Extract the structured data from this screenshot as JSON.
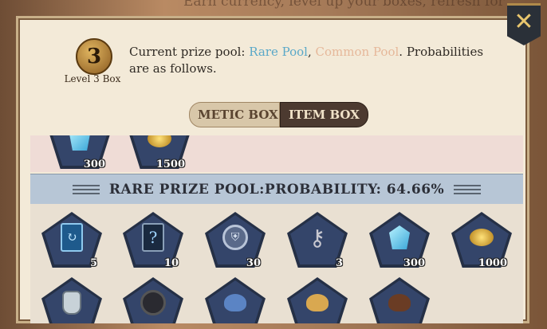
{
  "backdrop_text": "Earn currency, level up your boxes, refresh for",
  "close_icon": "close-x-icon",
  "box": {
    "level_number": "3",
    "level_label": "Level 3 Box"
  },
  "pool_info": {
    "prefix": "Current prize pool: ",
    "rare_label": "Rare Pool",
    "separator": ", ",
    "common_label": "Common Pool",
    "suffix": ". Probabilities are as follows."
  },
  "tabs": [
    {
      "label": "COSMETIC BOX",
      "visible_text": "METIC BOX",
      "active": false
    },
    {
      "label": "ITEM BOX",
      "active": true
    }
  ],
  "colors": {
    "rare": "#5aa8c8",
    "common": "#e6b89a",
    "tab_active": "#4c3a30"
  },
  "top_row_items": [
    {
      "icon": "gem-icon",
      "qty": "300"
    },
    {
      "icon": "coin-icon",
      "qty": "1500"
    }
  ],
  "rare_pool": {
    "title": "RARE PRIZE POOL:PROBABILITY: 64.66%",
    "items": [
      {
        "icon": "blue-card-icon",
        "qty": "5"
      },
      {
        "icon": "mystery-card-icon",
        "qty": "10"
      },
      {
        "icon": "shield-token-icon",
        "qty": "30"
      },
      {
        "icon": "key-icon",
        "qty": "3"
      },
      {
        "icon": "gem-icon",
        "qty": "300"
      },
      {
        "icon": "coin-icon",
        "qty": "1000"
      }
    ],
    "partial_items": [
      {
        "icon": "bottle-icon"
      },
      {
        "icon": "dark-token-icon"
      },
      {
        "icon": "blue-shell-icon"
      },
      {
        "icon": "gold-shell-icon"
      },
      {
        "icon": "brown-shell-icon"
      }
    ]
  }
}
